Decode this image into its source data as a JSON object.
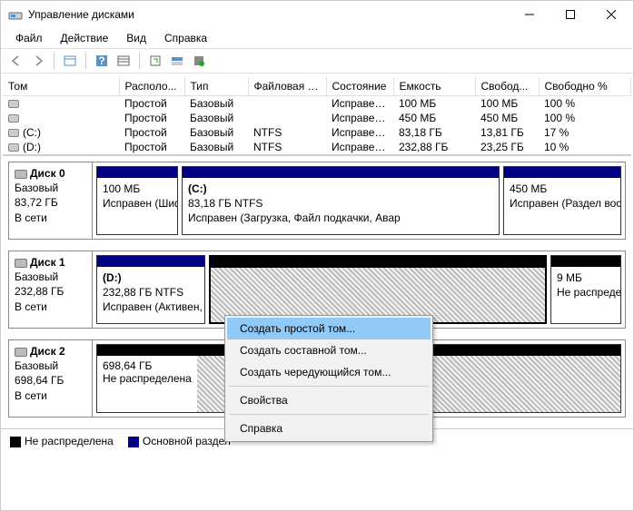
{
  "window": {
    "title": "Управление дисками"
  },
  "menu": {
    "file": "Файл",
    "action": "Действие",
    "view": "Вид",
    "help": "Справка"
  },
  "cols": {
    "tom": "Том",
    "raspo": "Располо...",
    "tip": "Тип",
    "fs": "Файловая с...",
    "state": "Состояние",
    "cap": "Емкость",
    "free": "Свобод...",
    "freep": "Свободно %"
  },
  "rows": [
    {
      "tom": "",
      "raspo": "Простой",
      "tip": "Базовый",
      "fs": "",
      "state": "Исправен...",
      "cap": "100 МБ",
      "free": "100 МБ",
      "freep": "100 %"
    },
    {
      "tom": "",
      "raspo": "Простой",
      "tip": "Базовый",
      "fs": "",
      "state": "Исправен...",
      "cap": "450 МБ",
      "free": "450 МБ",
      "freep": "100 %"
    },
    {
      "tom": "(C:)",
      "raspo": "Простой",
      "tip": "Базовый",
      "fs": "NTFS",
      "state": "Исправен...",
      "cap": "83,18 ГБ",
      "free": "13,81 ГБ",
      "freep": "17 %"
    },
    {
      "tom": "(D:)",
      "raspo": "Простой",
      "tip": "Базовый",
      "fs": "NTFS",
      "state": "Исправен...",
      "cap": "232,88 ГБ",
      "free": "23,25 ГБ",
      "freep": "10 %"
    }
  ],
  "disk0": {
    "name": "Диск 0",
    "type": "Базовый",
    "size": "83,72 ГБ",
    "status": "В сети",
    "p0": {
      "size": "100 МБ",
      "state": "Исправен (Шиф"
    },
    "p1": {
      "label": "(C:)",
      "size": "83,18 ГБ NTFS",
      "state": "Исправен (Загрузка, Файл подкачки, Авар"
    },
    "p2": {
      "size": "450 МБ",
      "state": "Исправен (Раздел вос"
    }
  },
  "disk1": {
    "name": "Диск 1",
    "type": "Базовый",
    "size": "232,88 ГБ",
    "status": "В сети",
    "p0": {
      "label": "(D:)",
      "size": "232,88 ГБ NTFS",
      "state": "Исправен (Активен,"
    },
    "p1": {
      "size": "9 МБ",
      "state": "Не распреде"
    }
  },
  "disk2": {
    "name": "Диск 2",
    "type": "Базовый",
    "size": "698,64 ГБ",
    "status": "В сети",
    "p0": {
      "size": "698,64 ГБ",
      "state": "Не распределена"
    }
  },
  "legend": {
    "unalloc": "Не распределена",
    "primary": "Основной раздел"
  },
  "ctx": {
    "simple": "Создать простой том...",
    "compound": "Создать составной том...",
    "striped": "Создать чередующийся том...",
    "props": "Свойства",
    "help": "Справка"
  }
}
